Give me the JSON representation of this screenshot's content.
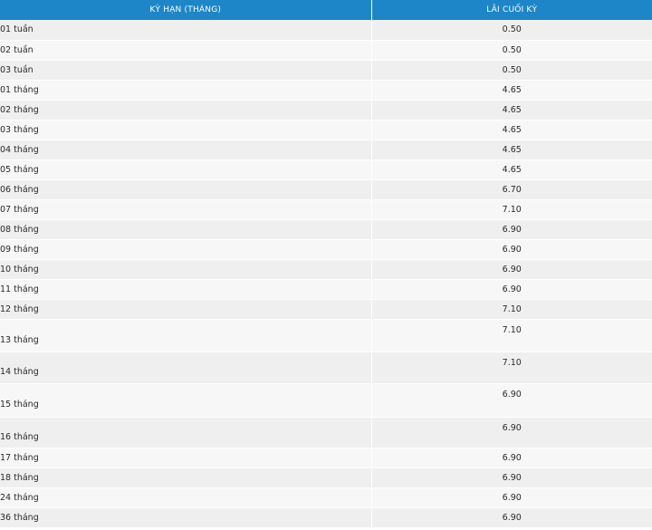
{
  "header": {
    "term_label": "KỲ HẠN (THÁNG)",
    "rate_label": "LÃI CUỐI KỲ"
  },
  "rows": [
    {
      "term": "01 tuần",
      "rate": "0.50"
    },
    {
      "term": "02 tuần",
      "rate": "0.50"
    },
    {
      "term": "03 tuần",
      "rate": "0.50"
    },
    {
      "term": "01 tháng",
      "rate": "4.65"
    },
    {
      "term": "02 tháng",
      "rate": "4.65"
    },
    {
      "term": "03 tháng",
      "rate": "4.65"
    },
    {
      "term": "04 tháng",
      "rate": "4.65"
    },
    {
      "term": "05 tháng",
      "rate": "4.65"
    },
    {
      "term": "06 tháng",
      "rate": "6.70"
    },
    {
      "term": "07 tháng",
      "rate": "7.10"
    },
    {
      "term": "08 tháng",
      "rate": "6.90"
    },
    {
      "term": "09 tháng",
      "rate": "6.90"
    },
    {
      "term": "10 tháng",
      "rate": "6.90"
    },
    {
      "term": "11 tháng",
      "rate": "6.90"
    },
    {
      "term": "12 tháng",
      "rate": "7.10"
    },
    {
      "term": "13 tháng",
      "rate": "7.10"
    },
    {
      "term": "14 tháng",
      "rate": "7.10"
    },
    {
      "term": "15 tháng",
      "rate": "6.90"
    },
    {
      "term": "16 tháng",
      "rate": "6.90"
    },
    {
      "term": "17 tháng",
      "rate": "6.90"
    },
    {
      "term": "18 tháng",
      "rate": "6.90"
    },
    {
      "term": "24 tháng",
      "rate": "6.90"
    },
    {
      "term": "36 tháng",
      "rate": "6.90"
    }
  ]
}
